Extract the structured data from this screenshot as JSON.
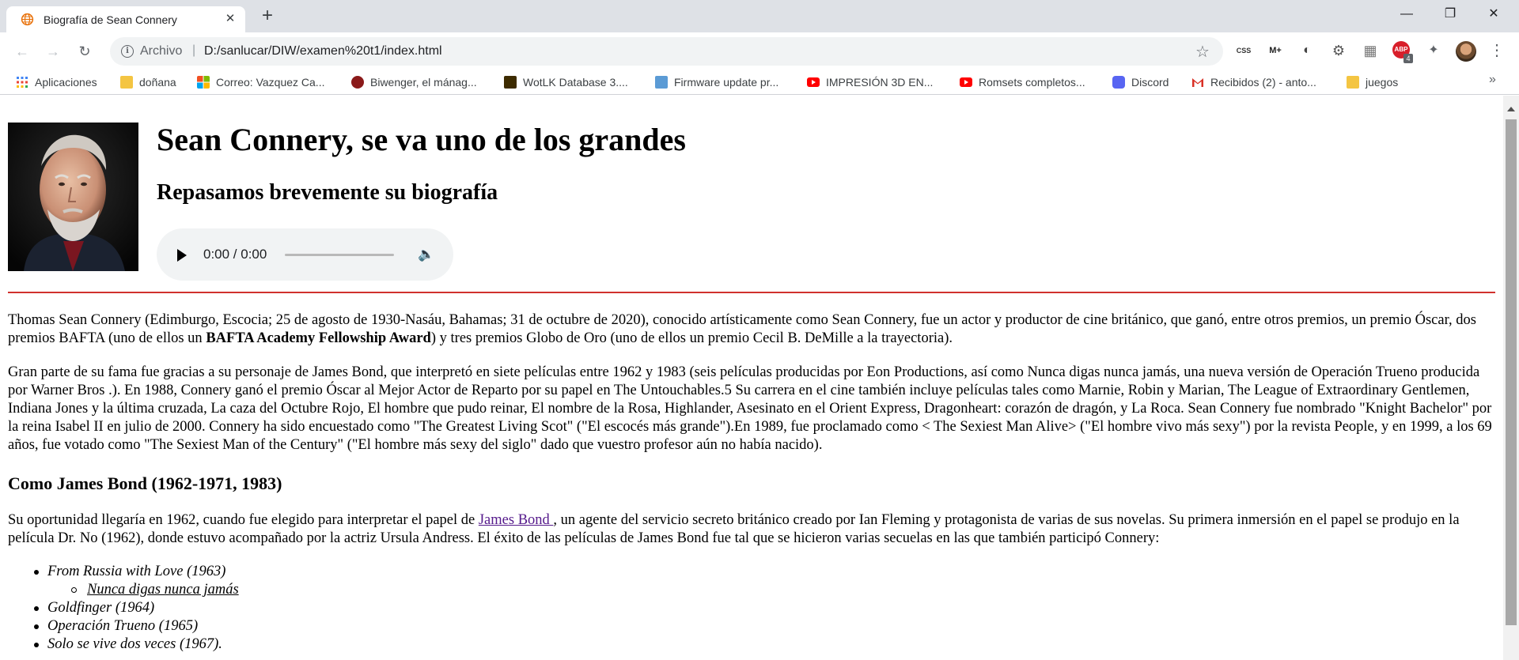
{
  "browser": {
    "tab_title": "Biografía de Sean Connery",
    "tab_close": "✕",
    "new_tab": "+",
    "window_controls": {
      "minimize": "—",
      "restore": "❐",
      "close": "✕"
    },
    "scheme_label": "Archivo",
    "separator": "|",
    "url": "D:/sanlucar/DIW/examen%20t1/index.html",
    "bookmark_star": "☆",
    "bookmarks_overflow": "»",
    "extensions": [
      {
        "name": "css-extension-icon",
        "label": "CSS"
      },
      {
        "name": "m-plus-extension-icon",
        "label": "M+"
      },
      {
        "name": "circle-extension-icon",
        "label": "◐"
      },
      {
        "name": "settings-extension-icon",
        "label": "⚙"
      },
      {
        "name": "chart-extension-icon",
        "label": "▦"
      },
      {
        "name": "adblock-extension-icon",
        "label": "ABP"
      },
      {
        "name": "puzzle-extension-icon",
        "label": "✦"
      }
    ],
    "adblock_badge": "4",
    "menu_dots": "⋮",
    "bookmarks": [
      {
        "label": "Aplicaciones",
        "icon": "apps-grid-icon",
        "color": "#4285f4"
      },
      {
        "label": "doñana",
        "icon": "folder-icon",
        "color": "#f4c542"
      },
      {
        "label": "Correo: Vazquez Ca...",
        "icon": "microsoft-icon",
        "color": "#f25022"
      },
      {
        "label": "Biwenger, el mánag...",
        "icon": "biwenger-icon",
        "color": "#8b1a1a"
      },
      {
        "label": "WotLK Database 3....",
        "icon": "wow-icon",
        "color": "#3d2b00"
      },
      {
        "label": "Firmware update pr...",
        "icon": "gt-icon",
        "color": "#5b9bd5"
      },
      {
        "label": "IMPRESIÓN 3D EN...",
        "icon": "youtube-icon",
        "color": "#ff0000"
      },
      {
        "label": "Romsets completos...",
        "icon": "youtube-icon",
        "color": "#ff0000"
      },
      {
        "label": "Discord",
        "icon": "discord-icon",
        "color": "#5865f2"
      },
      {
        "label": "Recibidos (2) - anto...",
        "icon": "gmail-icon",
        "color": "#d93025"
      },
      {
        "label": "juegos",
        "icon": "folder-icon",
        "color": "#f4c542"
      }
    ]
  },
  "page": {
    "title": "Sean Connery, se va uno de los grandes",
    "subtitle": "Repasamos brevemente su biografía",
    "audio": {
      "time": "0:00 / 0:00"
    },
    "p1_a": "Thomas Sean Connery (Edimburgo, Escocia; 25 de agosto de 1930-Nasáu, Bahamas; 31 de octubre de 2020), conocido artísticamente como Sean Connery, fue un actor y productor de cine británico, que ganó, entre otros premios, un premio Óscar, dos premios BAFTA (uno de ellos un ",
    "p1_bold": "BAFTA Academy Fellowship Award",
    "p1_b": ") y tres premios Globo de Oro (uno de ellos un premio Cecil B. DeMille a la trayectoria).",
    "p2": "Gran parte de su fama fue gracias a su personaje de James Bond, que interpretó en siete películas entre 1962 y 1983 (seis películas producidas por Eon Productions, así como Nunca digas nunca jamás, una nueva versión de Operación Trueno producida por Warner Bros .). En 1988, Connery ganó el premio Óscar al Mejor Actor de Reparto por su papel en The Untouchables.5 Su carrera en el cine también incluye películas tales como Marnie, Robin y Marian, The League of Extraordinary Gentlemen, Indiana Jones y la última cruzada, La caza del Octubre Rojo, El hombre que pudo reinar, El nombre de la Rosa, Highlander, Asesinato en el Orient Express, Dragonheart: corazón de dragón, y La Roca. Sean Connery fue nombrado \"Knight Bachelor\" por la reina Isabel II en julio de 2000. Connery ha sido encuestado como \"The Greatest Living Scot\" (\"El escocés más grande\").En 1989, fue proclamado como < The Sexiest Man Alive> (\"El hombre vivo más sexy\") por la revista People, y en 1999, a los 69 años, fue votado como \"The Sexiest Man of the Century\" (\"El hombre más sexy del siglo\" dado que vuestro profesor aún no había nacido).",
    "section_title": "Como James Bond (1962-1971, 1983)",
    "p3_a": "Su oportunidad llegaría en 1962, cuando fue elegido para interpretar el papel de ",
    "p3_link": "James Bond ",
    "p3_b": ", un agente del servicio secreto británico creado por Ian Fleming y protagonista de varias de sus novelas. Su primera inmersión en el papel se produjo en la película Dr. No (1962), donde estuvo acompañado por la actriz Ursula Andress. El éxito de las películas de James Bond fue tal que se hicieron varias secuelas en las que también participó Connery:",
    "films": [
      "From Russia with Love (1963)",
      "Nunca digas nunca jamás",
      "Goldfinger (1964)",
      "Operación Trueno (1965)",
      "Solo se vive dos veces (1967)."
    ]
  },
  "colors": {
    "rule": "#d0312d",
    "visited_link": "#551a8b",
    "chrome_tabstrip": "#dee1e6",
    "omnibox": "#f1f3f4"
  }
}
